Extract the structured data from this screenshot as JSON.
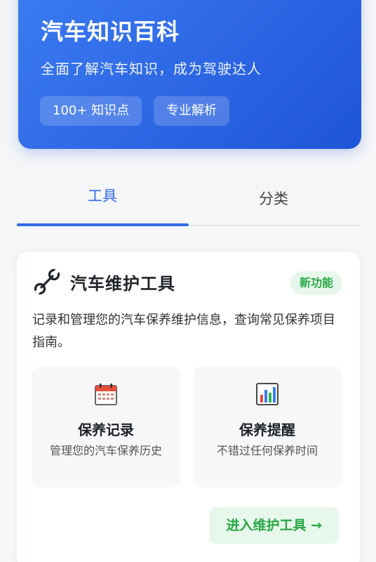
{
  "hero": {
    "title": "汽车知识百科",
    "subtitle": "全面了解汽车知识，成为驾驶达人",
    "chips": [
      "100+ 知识点",
      "专业解析"
    ]
  },
  "tabs": [
    {
      "label": "工具",
      "active": true
    },
    {
      "label": "分类",
      "active": false
    }
  ],
  "card": {
    "icon": "wrench-icon",
    "title": "汽车维护工具",
    "badge": "新功能",
    "description": "记录和管理您的汽车保养维护信息，查询常见保养项目指南。",
    "features": [
      {
        "icon": "calendar-icon",
        "title": "保养记录",
        "description": "管理您的汽车保养历史"
      },
      {
        "icon": "bar-chart-icon",
        "title": "保养提醒",
        "description": "不错过任何保养时间"
      }
    ],
    "enter_label": "进入维护工具 →"
  },
  "colors": {
    "primary": "#2f6ae6",
    "success": "#28a745",
    "success_bg": "#e8f7ec"
  }
}
